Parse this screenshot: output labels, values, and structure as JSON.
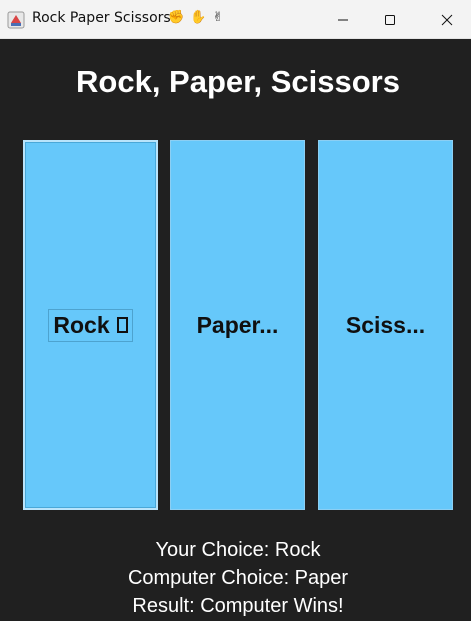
{
  "window": {
    "title": "Rock Paper Scissors",
    "title_icons": "✊ ✋ ✌",
    "controls": [
      "minimize-icon",
      "maximize-icon",
      "close-icon"
    ]
  },
  "game": {
    "heading": "Rock, Paper, Scissors",
    "buttons": {
      "rock": "Rock",
      "paper": "Paper...",
      "scissors": "Sciss..."
    }
  },
  "results": {
    "your_choice": "Your Choice: Rock",
    "computer_choice": "Computer Choice: Paper",
    "result": "Result: Computer Wins!"
  },
  "colors": {
    "background": "#202020",
    "button": "#66c8fa",
    "text": "#ffffff"
  }
}
